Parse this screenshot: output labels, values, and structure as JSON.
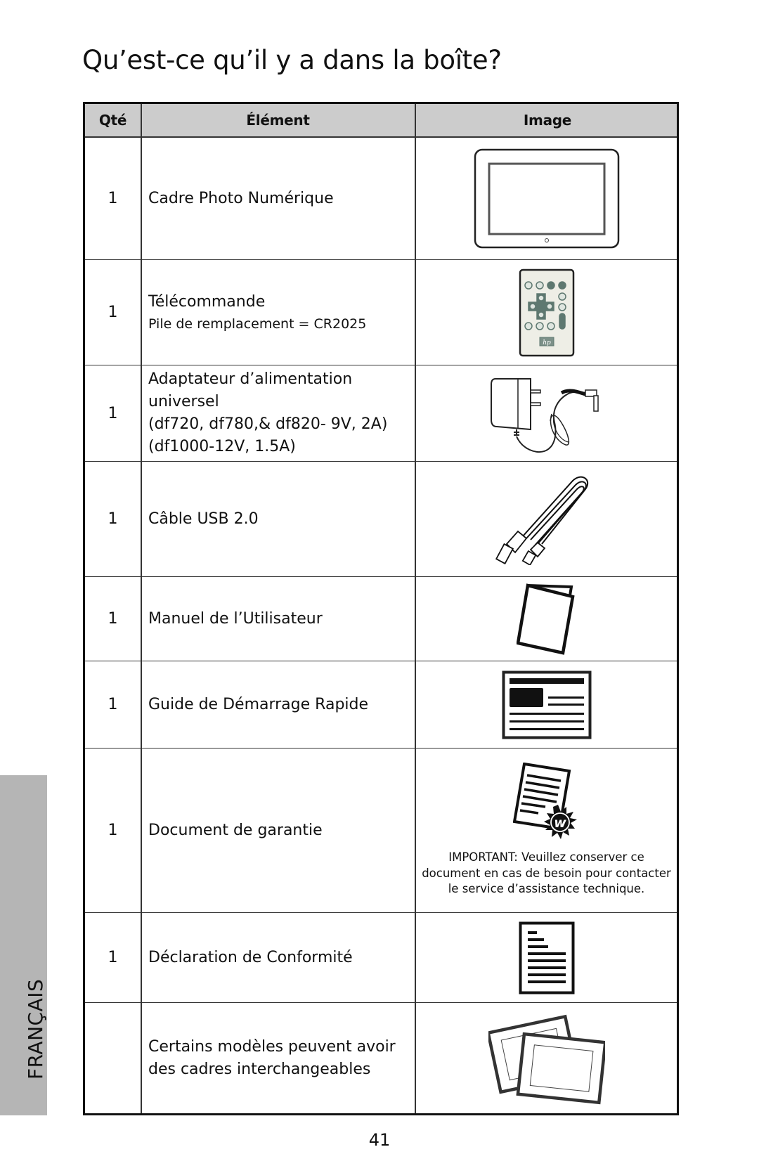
{
  "page": {
    "title": "Qu’est-ce qu’il y a dans la boîte?",
    "language_tab": "FRANÇAIS",
    "page_number": "41"
  },
  "table": {
    "headers": {
      "qty": "Qté",
      "element": "Élément",
      "image": "Image"
    },
    "header_bg": "#cccccc",
    "rows": [
      {
        "qty": "1",
        "element": "Cadre Photo Numérique",
        "sub": "",
        "image": "digital-photo-frame-icon"
      },
      {
        "qty": "1",
        "element": "Télécommande",
        "sub": "Pile de remplacement = CR2025",
        "image": "remote-control-icon"
      },
      {
        "qty": "1",
        "element_lines": [
          "Adaptateur d’alimentation",
          "universel",
          "(df720, df780,& df820- 9V, 2A)",
          "(df1000-12V, 1.5A)"
        ],
        "image": "power-adapter-icon"
      },
      {
        "qty": "1",
        "element": "Câble USB 2.0",
        "sub": "",
        "image": "usb-cable-icon"
      },
      {
        "qty": "1",
        "element": "Manuel de l’Utilisateur",
        "sub": "",
        "image": "user-manual-icon"
      },
      {
        "qty": "1",
        "element": "Guide de Démarrage Rapide",
        "sub": "",
        "image": "quick-start-guide-icon"
      },
      {
        "qty": "1",
        "element": "Document de garantie",
        "sub": "",
        "image": "warranty-document-icon",
        "note_lines": [
          "IMPORTANT: Veuillez conserver ce",
          "document en cas de besoin pour contacter",
          "le service d’assistance technique."
        ]
      },
      {
        "qty": "1",
        "element": "Déclaration de Conformité",
        "sub": "",
        "image": "declaration-document-icon"
      },
      {
        "qty": "",
        "element_lines": [
          "Certains modèles peuvent avoir",
          "des cadres interchangeables"
        ],
        "image": "interchangeable-frames-icon"
      }
    ]
  }
}
